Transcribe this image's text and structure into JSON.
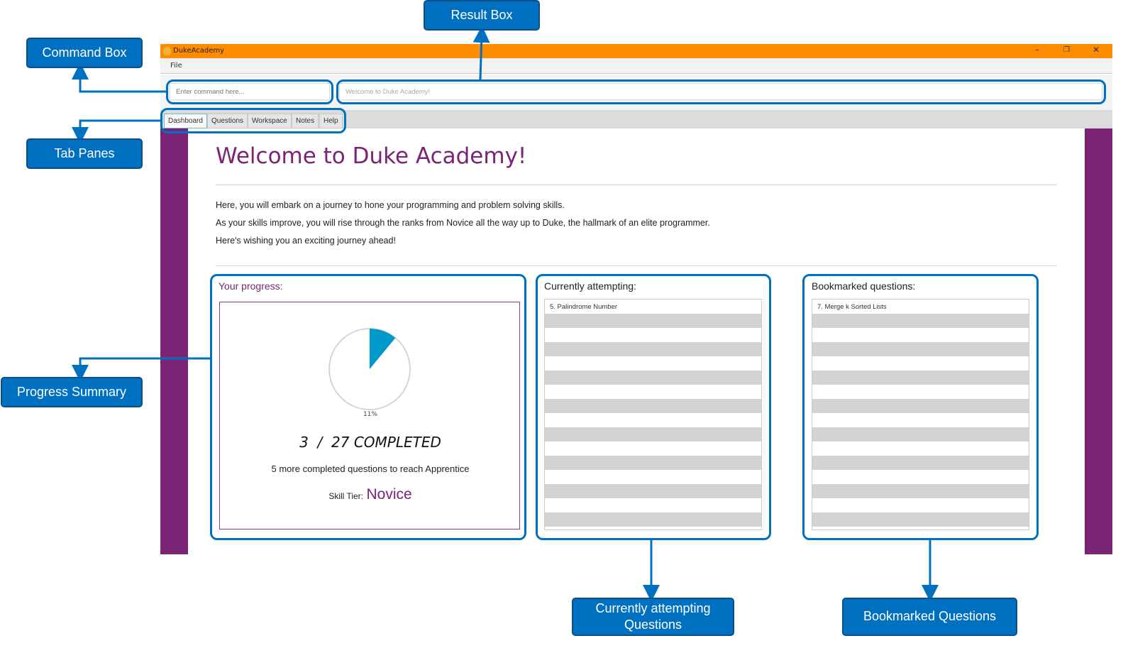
{
  "window": {
    "title": "DukeAcademy",
    "menu": [
      "File"
    ],
    "controls": [
      "minimize-icon",
      "restore-icon",
      "close-icon"
    ]
  },
  "command_box": {
    "placeholder": "Enter command here...",
    "value": ""
  },
  "result_box": {
    "text": "Welcome to Duke Academy!"
  },
  "tabs": [
    {
      "label": "Dashboard",
      "active": true
    },
    {
      "label": "Questions"
    },
    {
      "label": "Workspace"
    },
    {
      "label": "Notes"
    },
    {
      "label": "Help"
    }
  ],
  "dashboard": {
    "heading": "Welcome to Duke Academy!",
    "intro": [
      "Here, you will embark on a journey to hone your programming and problem solving skills.",
      "As your skills improve, you will rise through the ranks from Novice all the way up to Duke, the hallmark of an elite programmer.",
      "Here's wishing you an exciting journey ahead!"
    ],
    "progress": {
      "title": "Your progress:",
      "percent_label": "11%",
      "percent": 11,
      "completed": "3",
      "slash": "/",
      "total": "27 COMPLETED",
      "next_tier_text": "5 more completed questions to reach Apprentice",
      "skill_tier_label": "Skill Tier:",
      "skill_tier": "Novice"
    },
    "attempting": {
      "title": "Currently attempting:",
      "items": [
        "5. Palindrome Number"
      ]
    },
    "bookmarked": {
      "title": "Bookmarked questions:",
      "items": [
        "7. Merge k Sorted Lists"
      ]
    }
  },
  "annotations": {
    "command_box": "Command Box",
    "result_box": "Result Box",
    "tab_panes": "Tab Panes",
    "progress_summary": "Progress Summary",
    "attempting": "Currently attempting Questions",
    "bookmarked": "Bookmarked Questions"
  },
  "colors": {
    "title_bar": "#FF8C00",
    "accent_purple": "#7B2476",
    "pie": "#0099CC",
    "annotation": "#0070C0"
  }
}
